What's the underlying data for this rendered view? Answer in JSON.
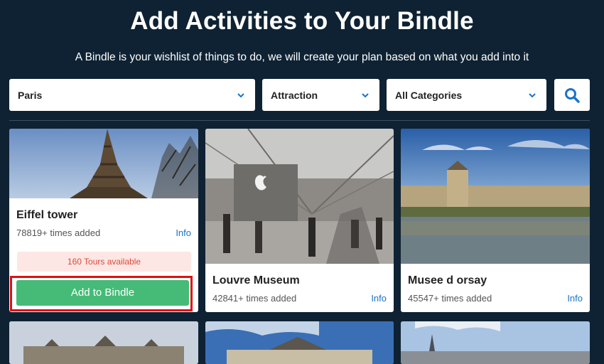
{
  "header": {
    "title": "Add Activities to Your Bindle",
    "subtitle": "A Bindle is your wishlist of things to do, we will create your plan based on what you add into it"
  },
  "filters": {
    "city": "Paris",
    "type": "Attraction",
    "category": "All Categories"
  },
  "cards": [
    {
      "name": "Eiffel tower",
      "added": "78819+ times added",
      "info": "Info",
      "tours": "160 Tours available",
      "button": "Add to Bindle"
    },
    {
      "name": "Louvre Museum",
      "added": "42841+ times added",
      "info": "Info"
    },
    {
      "name": "Musee d orsay",
      "added": "45547+ times added",
      "info": "Info"
    }
  ],
  "colors": {
    "background": "#0e2233",
    "accent": "#1a73c8",
    "add_button": "#45bb77",
    "tours_text": "#e0473a",
    "highlight": "#e01010"
  }
}
